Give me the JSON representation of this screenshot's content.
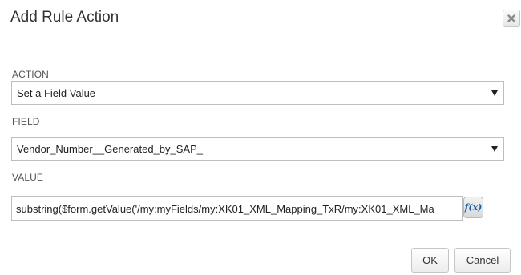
{
  "dialog": {
    "title": "Add Rule Action",
    "close_icon": "close-x-icon"
  },
  "action": {
    "label": "ACTION",
    "selected": "Set a Field Value",
    "icon": "dropdown-arrow-icon"
  },
  "field": {
    "label": "FIELD",
    "selected": "Vendor_Number__Generated_by_SAP_",
    "icon": "dropdown-arrow-icon"
  },
  "value": {
    "label": "VALUE",
    "text": "substring($form.getValue('/my:myFields/my:XK01_XML_Mapping_TxR/my:XK01_XML_Ma",
    "fx_label": "f(x)"
  },
  "buttons": {
    "ok": "OK",
    "cancel": "Cancel"
  },
  "colors": {
    "border": "#bdbdbd",
    "fx_text": "#1f5fa8",
    "header_divider": "#e2e2e2"
  }
}
